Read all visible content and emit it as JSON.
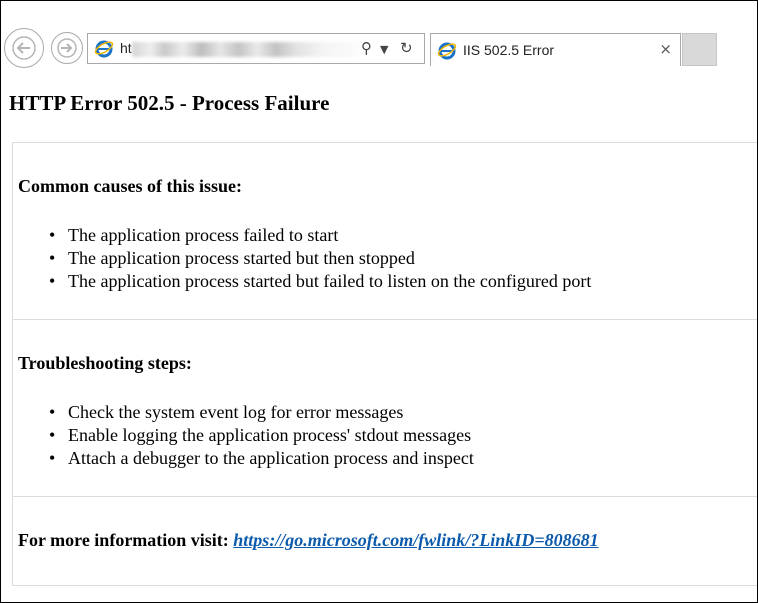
{
  "browser": {
    "address_text": "ht",
    "tab": {
      "title": "IIS 502.5 Error",
      "close_glyph": "×"
    },
    "icons": {
      "back": "back-arrow-icon",
      "forward": "forward-arrow-icon",
      "search": "search-icon",
      "dropdown": "dropdown-arrow-icon",
      "refresh": "refresh-icon",
      "site": "internet-explorer-icon"
    },
    "colors": {
      "ie_blue": "#1a73c9",
      "ie_ring": "#f2b705"
    }
  },
  "page": {
    "title": "HTTP Error 502.5 - Process Failure",
    "sections": [
      {
        "heading": "Common causes of this issue:",
        "items": [
          "The application process failed to start",
          "The application process started but then stopped",
          "The application process started but failed to listen on the configured port"
        ]
      },
      {
        "heading": "Troubleshooting steps:",
        "items": [
          "Check the system event log for error messages",
          "Enable logging the application process' stdout messages",
          "Attach a debugger to the application process and inspect"
        ]
      }
    ],
    "more_info": {
      "label": "For more information visit:",
      "link_text": "https://go.microsoft.com/fwlink/?LinkID=808681",
      "link_color": "#0b5aab"
    }
  }
}
